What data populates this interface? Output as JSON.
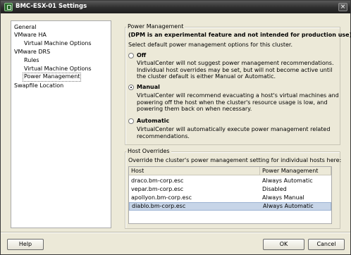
{
  "window": {
    "title": "BMC-ESX-01 Settings",
    "close_glyph": "×",
    "icon": "vm-settings-icon"
  },
  "tree": {
    "items": [
      {
        "label": "General"
      },
      {
        "label": "VMware HA"
      },
      {
        "label": "Virtual Machine Options"
      },
      {
        "label": "VMware DRS"
      },
      {
        "label": "Rules"
      },
      {
        "label": "Virtual Machine Options"
      },
      {
        "label": "Power Management"
      },
      {
        "label": "Swapfile Location"
      }
    ],
    "selected": "Power Management"
  },
  "power_management": {
    "group_title": "Power Management",
    "warning": "(DPM is an experimental feature and not intended for production use)",
    "instruction": "Select default power management options for this cluster.",
    "options": [
      {
        "label": "Off",
        "checked": false,
        "description": [
          "VirtualCenter will not suggest power management recommendations.",
          "Individual host overrides may be set, but will not become active until",
          "the cluster default is either Manual or Automatic."
        ]
      },
      {
        "label": "Manual",
        "checked": true,
        "description": [
          "VirtualCenter will recommend evacuating a host's virtual machines and",
          "powering off the host when the cluster's resource usage is low, and",
          "powering them back on when necessary."
        ]
      },
      {
        "label": "Automatic",
        "checked": false,
        "description": [
          "VirtualCenter will automatically execute power management related",
          "recommendations."
        ]
      }
    ]
  },
  "host_overrides": {
    "group_title": "Host Overrides",
    "instruction": "Override the cluster's power management setting for individual hosts here:",
    "columns": [
      "Host",
      "Power Management"
    ],
    "rows": [
      {
        "host": "draco.bm-corp.esc",
        "pm": "Always Automatic",
        "selected": false
      },
      {
        "host": "vepar.bm-corp.esc",
        "pm": "Disabled",
        "selected": false
      },
      {
        "host": "apollyon.bm-corp.esc",
        "pm": "Always Manual",
        "selected": false
      },
      {
        "host": "diablo.bm-corp.esc",
        "pm": "Always Automatic",
        "selected": true
      }
    ]
  },
  "footer": {
    "help": "Help",
    "ok": "OK",
    "cancel": "Cancel"
  }
}
